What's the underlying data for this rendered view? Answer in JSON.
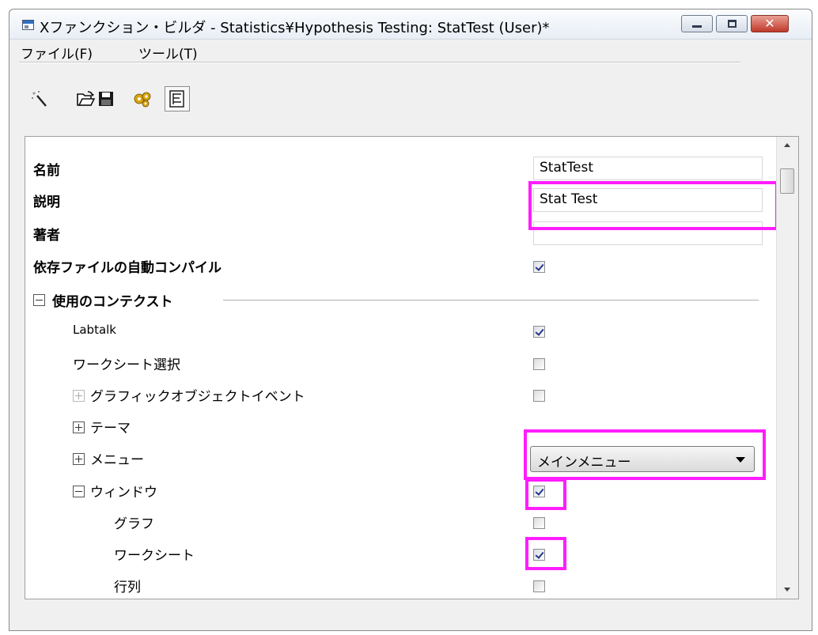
{
  "window": {
    "title": "Xファンクション・ビルダ - Statistics¥Hypothesis Testing: StatTest (User)*",
    "close_glyph": "✕"
  },
  "menu": {
    "file": "ファイル(F)",
    "tools": "ツール(T)"
  },
  "toolbar": {
    "items": [
      {
        "icon": "magic-wand-icon"
      },
      {
        "icon": "folder-open-icon"
      },
      {
        "icon": "save-icon"
      },
      {
        "icon": "gear-icon"
      },
      {
        "icon": "tree-view-icon"
      }
    ]
  },
  "properties": {
    "name_label": "名前",
    "name_value": "StatTest",
    "description_label": "説明",
    "description_value": "Stat Test",
    "author_label": "著者",
    "author_value": "",
    "autocompile_label": "依存ファイルの自動コンパイル",
    "autocompile_checked": true
  },
  "context": {
    "section_label": "使用のコンテクスト",
    "labtalk_label": "Labtalk",
    "labtalk_checked": true,
    "worksheet_sel_label": "ワークシート選択",
    "worksheet_sel_checked": false,
    "graphic_obj_label": "グラフィックオブジェクトイベント",
    "graphic_obj_checked": false,
    "theme_label": "テーマ",
    "menu_label": "メニュー",
    "menu_value": "メインメニュー",
    "window_label": "ウィンドウ",
    "window_checked": true,
    "graph_label": "グラフ",
    "graph_checked": false,
    "worksheet_label": "ワークシート",
    "worksheet_checked": true,
    "matrix_label": "行列",
    "matrix_checked": false
  },
  "highlight_color": "#ff1dff"
}
